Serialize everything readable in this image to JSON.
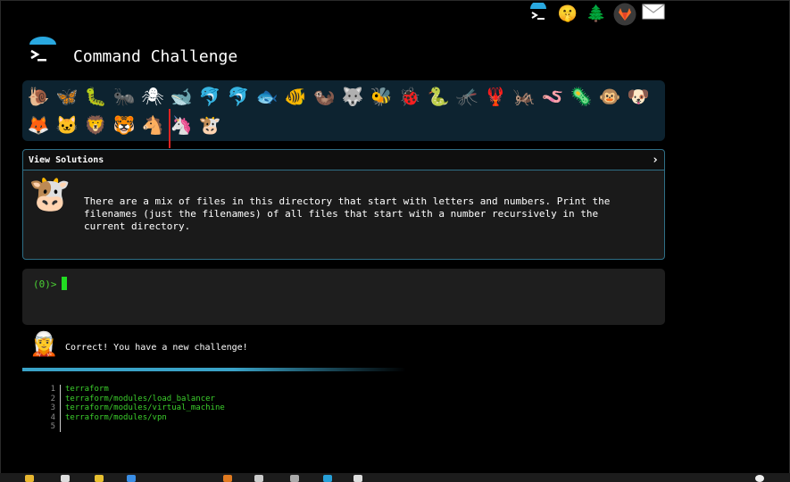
{
  "app": {
    "title": "Command Challenge"
  },
  "nav_icons": [
    "command-challenge-icon",
    "shush-emoji-icon",
    "tree-icon",
    "gitlab-icon",
    "mail-icon"
  ],
  "animal_tray": {
    "row1": [
      "🐌",
      "🦋",
      "🐛",
      "🐜",
      "🕷",
      "🐋",
      "🐬",
      "🐬",
      "🐟",
      "🐠",
      "🦦",
      "🐺",
      "🐝",
      "🐞",
      "🐍",
      "🦟",
      "🦞",
      "🦗",
      "🪱",
      "🦠",
      "🐵",
      "🐶"
    ],
    "row2": [
      "🦊",
      "🐱",
      "🦁",
      "🐯",
      "🐴",
      "🦄",
      "🐮"
    ],
    "row1_names": [
      "snail",
      "butterfly",
      "caterpillar",
      "ant",
      "spider",
      "whale",
      "dolphin",
      "shark",
      "fish",
      "tropical-fish",
      "otter",
      "wolf",
      "bee",
      "ladybug",
      "snake",
      "mosquito",
      "lobster",
      "fly",
      "worm",
      "microbe",
      "monkey",
      "dog"
    ],
    "row2_names": [
      "fox",
      "cat",
      "lion",
      "tiger",
      "horse",
      "unicorn",
      "cow"
    ]
  },
  "challenge": {
    "header": "View Solutions",
    "text": "There are a mix of files in this directory that start with letters and numbers. Print the filenames (just the filenames) of all files that start with a number recursively in the current directory.",
    "avatar": "🐮"
  },
  "terminal": {
    "prompt": "(0)>"
  },
  "feedback": {
    "avatar": "🧝",
    "message": "Correct! You have a new challenge!"
  },
  "output": {
    "lines": [
      {
        "n": "1",
        "text": "terraform"
      },
      {
        "n": "2",
        "text": "terraform/modules/load_balancer"
      },
      {
        "n": "3",
        "text": "terraform/modules/virtual_machine"
      },
      {
        "n": "4",
        "text": "terraform/modules/vpn"
      },
      {
        "n": "5",
        "text": ""
      }
    ]
  },
  "colors": {
    "background": "#000000",
    "tray": "#0d2330",
    "accent": "#2f6f86",
    "prompt_green": "#4cd134",
    "output_green": "#3ccf2c"
  }
}
